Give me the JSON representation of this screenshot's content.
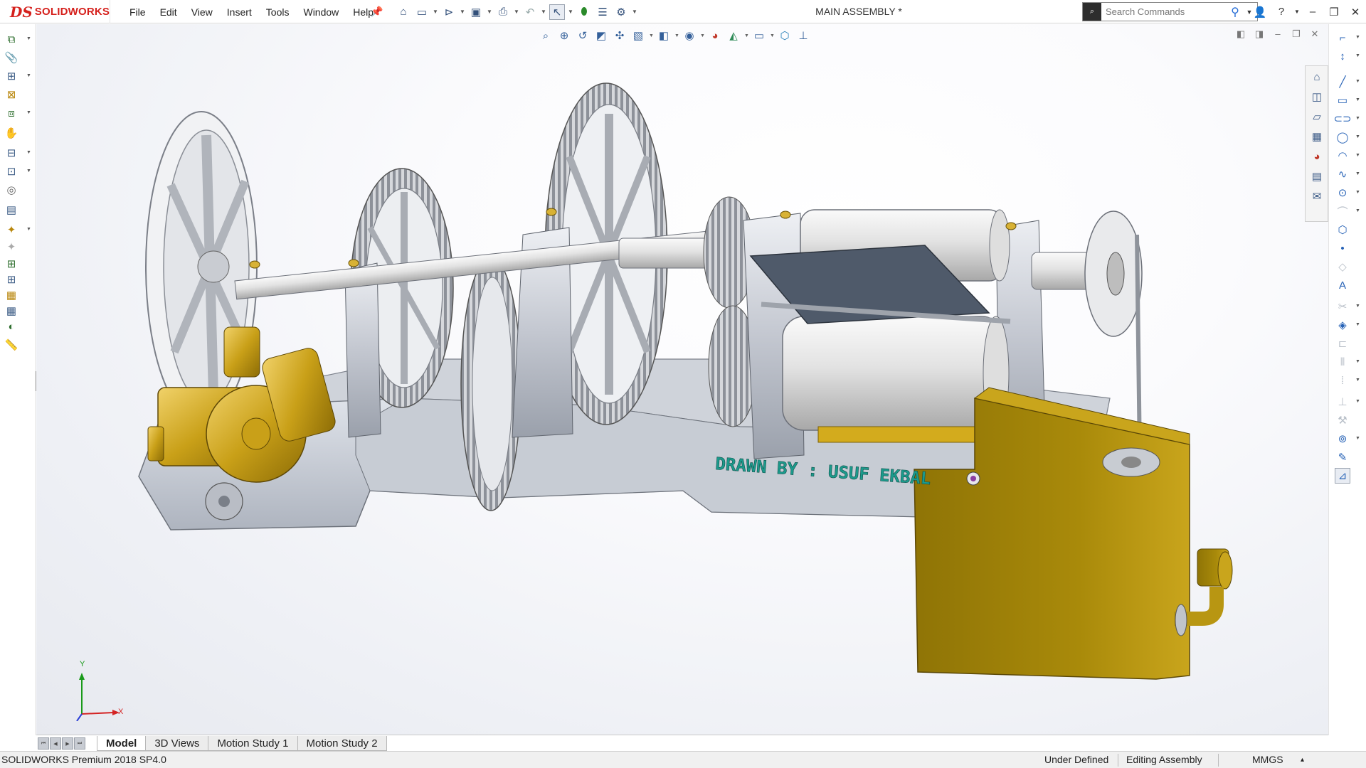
{
  "app": {
    "logo_ds": "DS",
    "logo_word": "SOLIDWORKS",
    "document_title": "MAIN ASSEMBLY *"
  },
  "menu": [
    "File",
    "Edit",
    "View",
    "Insert",
    "Tools",
    "Window",
    "Help"
  ],
  "search": {
    "placeholder": "Search Commands"
  },
  "qa_icons": [
    "home-icon",
    "new-document-icon",
    "open-icon",
    "save-icon",
    "print-icon",
    "undo-icon",
    "select-icon",
    "rebuild-icon",
    "file-properties-icon",
    "options-icon"
  ],
  "hud_icons": [
    "zoom-to-fit-icon",
    "zoom-to-area-icon",
    "previous-view-icon",
    "section-view-icon",
    "dynamic-annotation-icon",
    "view-orientation-icon",
    "display-style-icon",
    "hide-show-icon",
    "edit-appearance-icon",
    "apply-scene-icon",
    "view-settings-icon",
    "display-pane-icon",
    "move-triad-icon"
  ],
  "model_annotation": "DRAWN BY : USUF EKBAL",
  "triad": {
    "y": "Y",
    "x": "X"
  },
  "bottom_tabs": [
    "Model",
    "3D Views",
    "Motion Study 1",
    "Motion Study 2"
  ],
  "status": {
    "product": "SOLIDWORKS Premium 2018 SP4.0",
    "definition": "Under Defined",
    "mode": "Editing Assembly",
    "units": "MMGS",
    "units_arrow": "▴"
  },
  "colors": {
    "brand_red": "#d5201c",
    "steel": "#c9ccd3",
    "brass": "#b8940f",
    "tank": "#a98a0a",
    "label_teal": "#1c9a8c"
  }
}
